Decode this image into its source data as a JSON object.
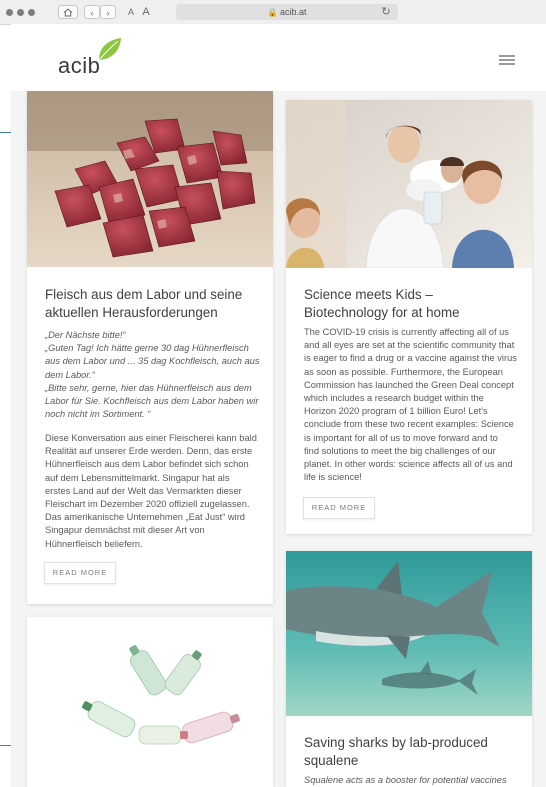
{
  "browser": {
    "url": "acib.at",
    "text_size_small": "A",
    "text_size_large": "A"
  },
  "site": {
    "logo_text": "acib"
  },
  "articles": [
    {
      "title": "Fleisch aus dem Labor und seine aktuellen Herausforderungen",
      "quote_lines": [
        "„Der Nächste bitte!“",
        "„Guten Tag! Ich hätte gerne 30 dag Hühnerfleisch",
        "aus dem Labor und ... 35 dag Kochfleisch, auch aus",
        "dem Labor.“",
        "„Bitte sehr, gerne, hier das Hühnerfleisch aus dem",
        "Labor für Sie. Kochfleisch aus dem Labor haben wir",
        "noch nicht im Sortiment. “"
      ],
      "body_lines": [
        "Diese Konversation aus einer Fleischerei kann bald",
        "Realität auf unserer Erde werden. Denn, das erste",
        "Hühnerfleisch aus dem Labor befindet sich schon",
        "auf dem Lebensmittelmarkt. Singapur hat als",
        "erstes Land auf der Welt das Vermarkten dieser",
        "Fleischart im Dezember 2020 offiziell zugelassen.",
        "Das amerikanische Unternehmen „Eat Just“ wird",
        "Singapur demnächst mit dieser Art von",
        "Hühnerfleisch beliefern."
      ],
      "button": "READ MORE"
    },
    {
      "title": "Science meets Kids – Biotechnology for at home",
      "body_lines": [
        "The COVID-19 crisis is currently affecting all of us",
        "and all eyes are set at the scientific community that",
        "is eager to find a drug or a vaccine against the virus",
        "as soon as possible. Furthermore, the European",
        "Commission has launched the Green Deal concept",
        "which includes a research budget within the",
        "Horizon 2020 program of 1 billion Euro! Let's",
        "conclude from these two recent examples: Science",
        "is important for all of us to move forward and to",
        "find solutions to meet the big challenges of our",
        "planet. In other words: science affects all of us and",
        "life is science!"
      ],
      "button": "READ MORE"
    },
    {
      "title": "Saving sharks by lab-produced squalene",
      "subtitle": "Squalene acts as a booster for potential vaccines"
    }
  ],
  "colors": {
    "accent_green": "#8dc63f",
    "deco_blue": "#3d7fa8"
  }
}
